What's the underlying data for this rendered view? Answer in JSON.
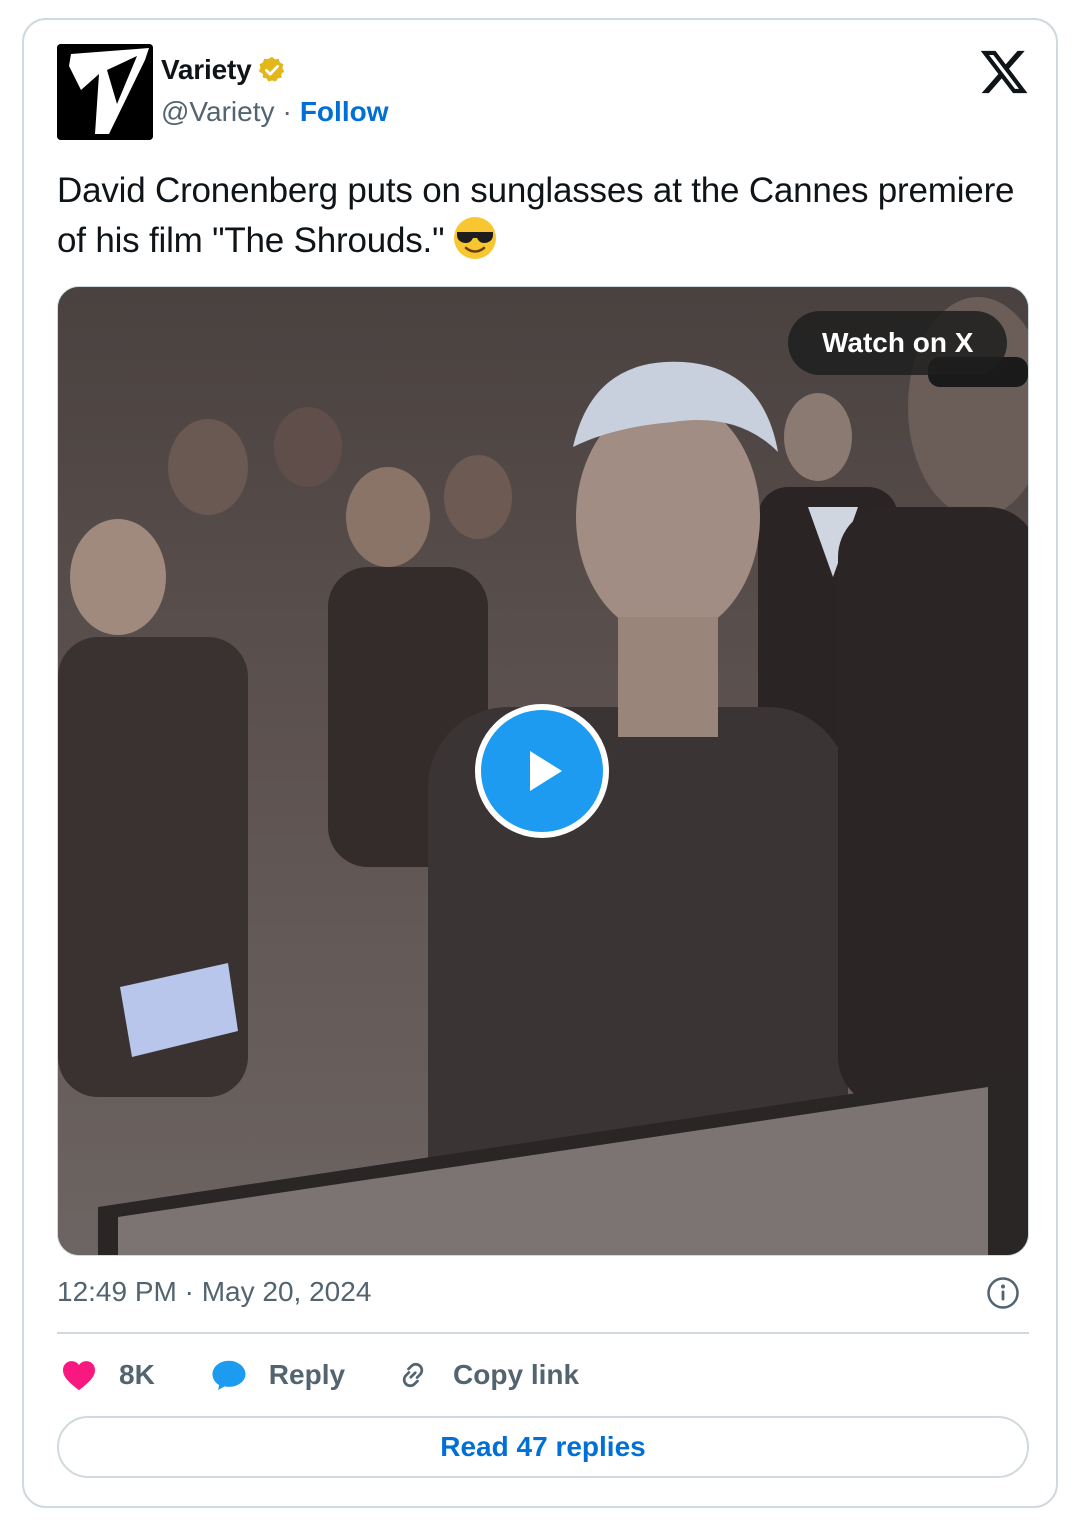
{
  "author": {
    "name": "Variety",
    "handle": "@Variety",
    "separator": "·",
    "follow_label": "Follow",
    "verified_badge": "gold-verified-badge-icon"
  },
  "tweet": {
    "text": "David Cronenberg puts on sunglasses at the Cannes premiere of his film \"The Shrouds.\"",
    "emoji": "smiling-face-with-sunglasses-icon"
  },
  "media": {
    "watch_label": "Watch on X",
    "play_icon": "play-icon"
  },
  "meta": {
    "timestamp": "12:49 PM · May 20, 2024"
  },
  "actions": {
    "likes": "8K",
    "reply_label": "Reply",
    "copy_label": "Copy link"
  },
  "read_replies_label": "Read 47 replies",
  "colors": {
    "link_blue": "#006fd6",
    "play_blue": "#1d9bf0",
    "like_pink": "#f91880",
    "muted_text": "#536471",
    "border": "#cfd9de"
  }
}
